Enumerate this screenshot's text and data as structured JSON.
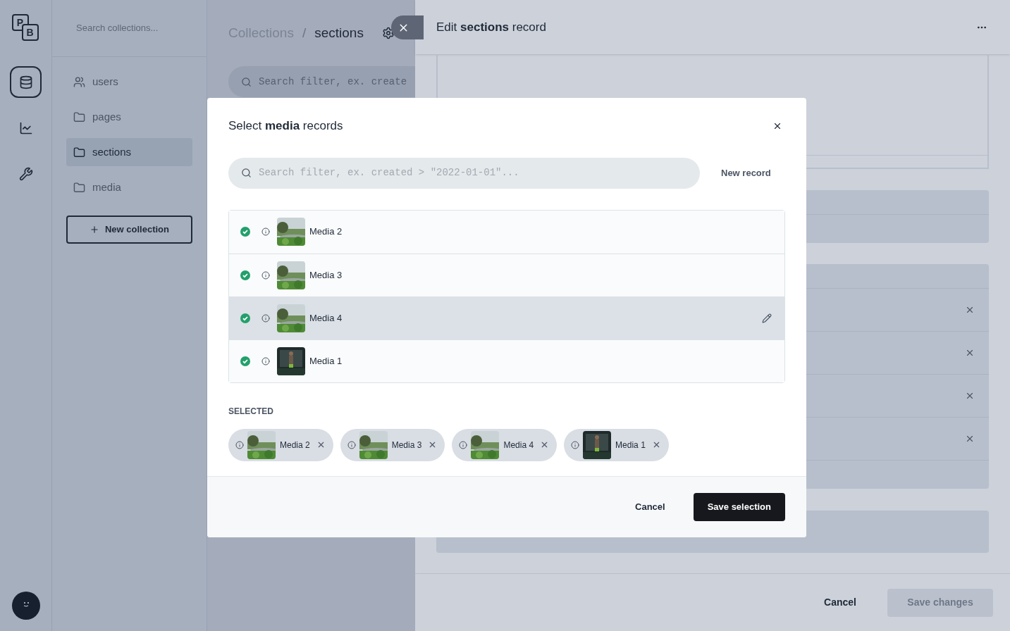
{
  "app_bar": {
    "logo_letters": [
      "P",
      "B"
    ],
    "nav": [
      {
        "kind": "database",
        "selected": true
      },
      {
        "kind": "chart",
        "selected": false
      },
      {
        "kind": "tools",
        "selected": false
      }
    ]
  },
  "collections_sidebar": {
    "search_placeholder": "Search collections...",
    "items": [
      {
        "label": "users",
        "kind": "users",
        "selected": false
      },
      {
        "label": "pages",
        "kind": "folder",
        "selected": false
      },
      {
        "label": "sections",
        "kind": "folder",
        "selected": true
      },
      {
        "label": "media",
        "kind": "folder",
        "selected": false
      }
    ],
    "new_button": "New collection"
  },
  "breadcrumb": {
    "parent": "Collections",
    "separator": "/",
    "current": "sections"
  },
  "list_search": {
    "placeholder": "Search filter, ex. create"
  },
  "record_panel": {
    "title": "Edit **sections** record",
    "relation_rows": [
      {
        "removable": true
      },
      {
        "removable": true
      },
      {
        "removable": true
      },
      {
        "removable": true
      }
    ],
    "cancel": "Cancel",
    "save": "Save changes",
    "save_disabled": true
  },
  "modal": {
    "title": "Select **media** records",
    "search_placeholder": "Search filter, ex. created > \"2022-01-01\"...",
    "new_record": "New record",
    "records": [
      {
        "name": "Media 2",
        "selected": true,
        "hovered": false
      },
      {
        "name": "Media 3",
        "selected": true,
        "hovered": false
      },
      {
        "name": "Media 4",
        "selected": true,
        "hovered": true
      },
      {
        "name": "Media 1",
        "selected": true,
        "hovered": false
      }
    ],
    "selected_label": "SELECTED",
    "chips": [
      {
        "name": "Media 2"
      },
      {
        "name": "Media 3"
      },
      {
        "name": "Media 4"
      },
      {
        "name": "Media 1"
      }
    ],
    "cancel": "Cancel",
    "save": "Save selection"
  }
}
